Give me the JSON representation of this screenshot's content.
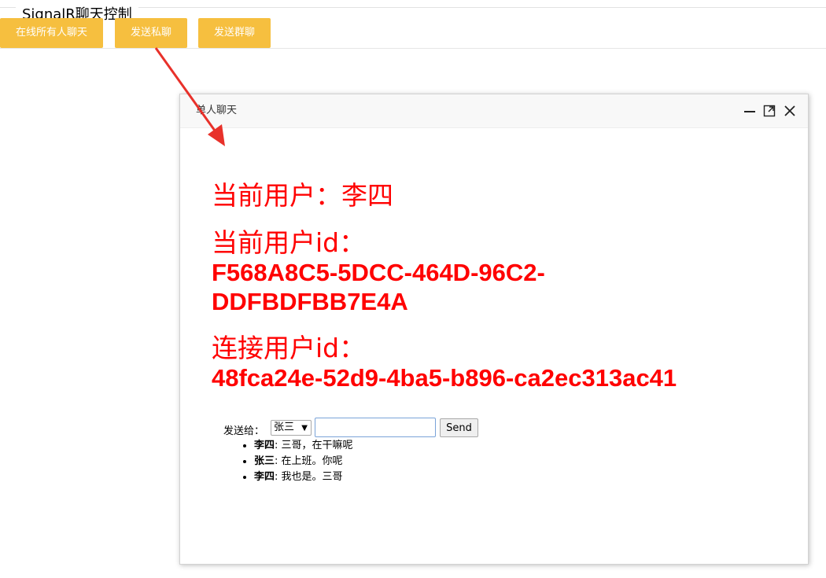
{
  "header": {
    "title": "SignalR聊天控制"
  },
  "toolbar": {
    "buttons": [
      {
        "label": "在线所有人聊天"
      },
      {
        "label": "发送私聊"
      },
      {
        "label": "发送群聊"
      }
    ]
  },
  "colors": {
    "toolbar_button": "#f6bf3f",
    "info_text": "#ff0000",
    "arrow": "#e8312a"
  },
  "dialog": {
    "title": "单人聊天",
    "controls": [
      "minimize-icon",
      "maximize-icon",
      "close-icon"
    ],
    "current_user_label": "当前用户：",
    "current_user_name": "李四",
    "current_user_id_label": "当前用户id：",
    "current_user_id": "F568A8C5-5DCC-464D-96C2-DDFBDFBB7E4A",
    "connection_id_label": "连接用户id：",
    "connection_id": "48fca24e-52d9-4ba5-b896-ca2ec313ac41",
    "send_to_label": "发送给：",
    "recipient_selected": "张三",
    "message_input_value": "",
    "send_button_label": "Send",
    "messages": [
      {
        "sender": "李四",
        "text": ": 三哥，在干嘛呢"
      },
      {
        "sender": "张三",
        "text": ": 在上班。你呢"
      },
      {
        "sender": "李四",
        "text": ": 我也是。三哥"
      }
    ]
  }
}
